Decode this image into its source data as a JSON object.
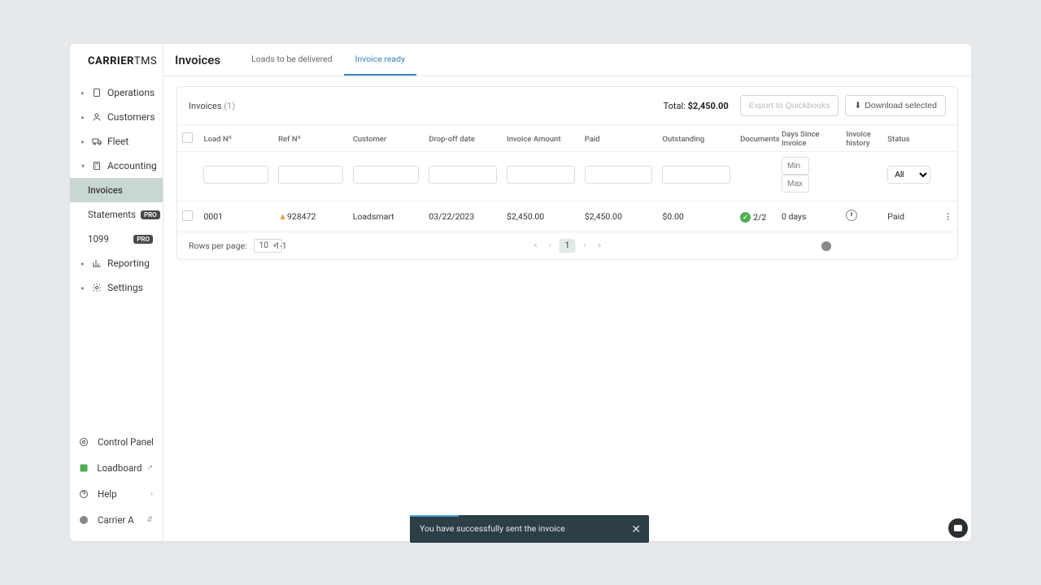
{
  "brand": {
    "name": "CARRIER",
    "suffix": "TMS"
  },
  "sidebar": {
    "items": [
      {
        "label": "Operations"
      },
      {
        "label": "Customers"
      },
      {
        "label": "Fleet"
      },
      {
        "label": "Accounting"
      },
      {
        "label": "Invoices"
      },
      {
        "label": "Statements",
        "badge": "PRO"
      },
      {
        "label": "1099",
        "badge": "PRO"
      },
      {
        "label": "Reporting"
      },
      {
        "label": "Settings"
      }
    ],
    "bottom": [
      {
        "label": "Control Panel"
      },
      {
        "label": "Loadboard"
      },
      {
        "label": "Help"
      },
      {
        "label": "Carrier A"
      }
    ]
  },
  "header": {
    "title": "Invoices",
    "tabs": [
      {
        "label": "Loads to be delivered"
      },
      {
        "label": "Invoice ready"
      }
    ]
  },
  "panel": {
    "title": "Invoices",
    "count": "(1)",
    "total_label": "Total:",
    "total_value": "$2,450.00",
    "export_btn": "Export to Quickbooks",
    "download_btn": "Download selected"
  },
  "columns": {
    "load": "Load Nº",
    "ref": "Ref Nº",
    "customer": "Customer",
    "dropoff": "Drop-off date",
    "amount": "Invoice Amount",
    "paid": "Paid",
    "outstanding": "Outstanding",
    "documents": "Documents",
    "days": "Days Since Invoice",
    "history": "Invoice history",
    "status": "Status"
  },
  "filters": {
    "min": "Min",
    "max": "Max",
    "status_all": "All"
  },
  "row": {
    "load": "0001",
    "ref": "928472",
    "customer": "Loadsmart",
    "dropoff": "03/22/2023",
    "amount": "$2,450.00",
    "paid": "$2,450.00",
    "outstanding": "$0.00",
    "documents": "2/2",
    "days": "0 days",
    "status": "Paid"
  },
  "pagination": {
    "rows_label": "Rows per page:",
    "page_size": "10",
    "range": "1-1",
    "current": "1"
  },
  "toast": {
    "message": "You have successfully sent the invoice"
  }
}
